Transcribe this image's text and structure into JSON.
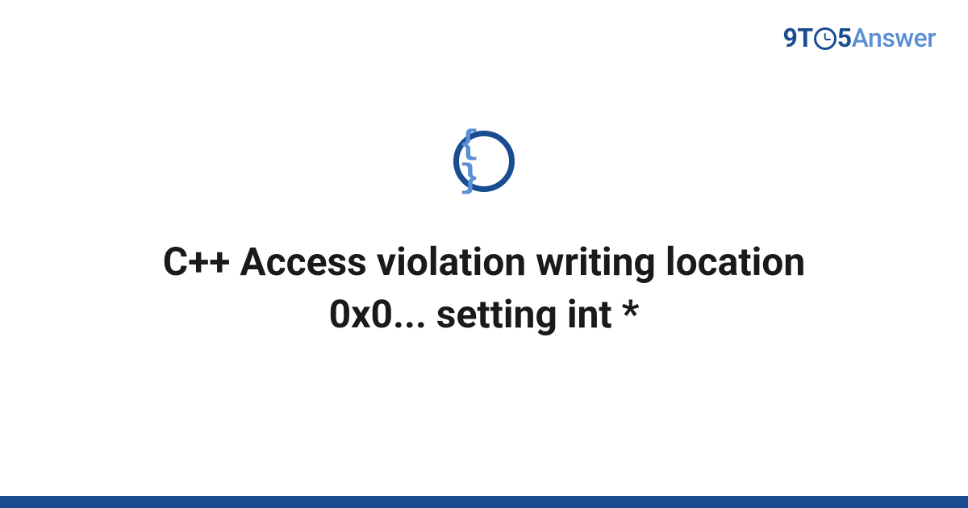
{
  "logo": {
    "part1": "9T",
    "part2": "5",
    "part3": "Answer"
  },
  "icon": {
    "glyph": "{ }"
  },
  "title": "C++ Access violation writing location 0x0... setting int *"
}
